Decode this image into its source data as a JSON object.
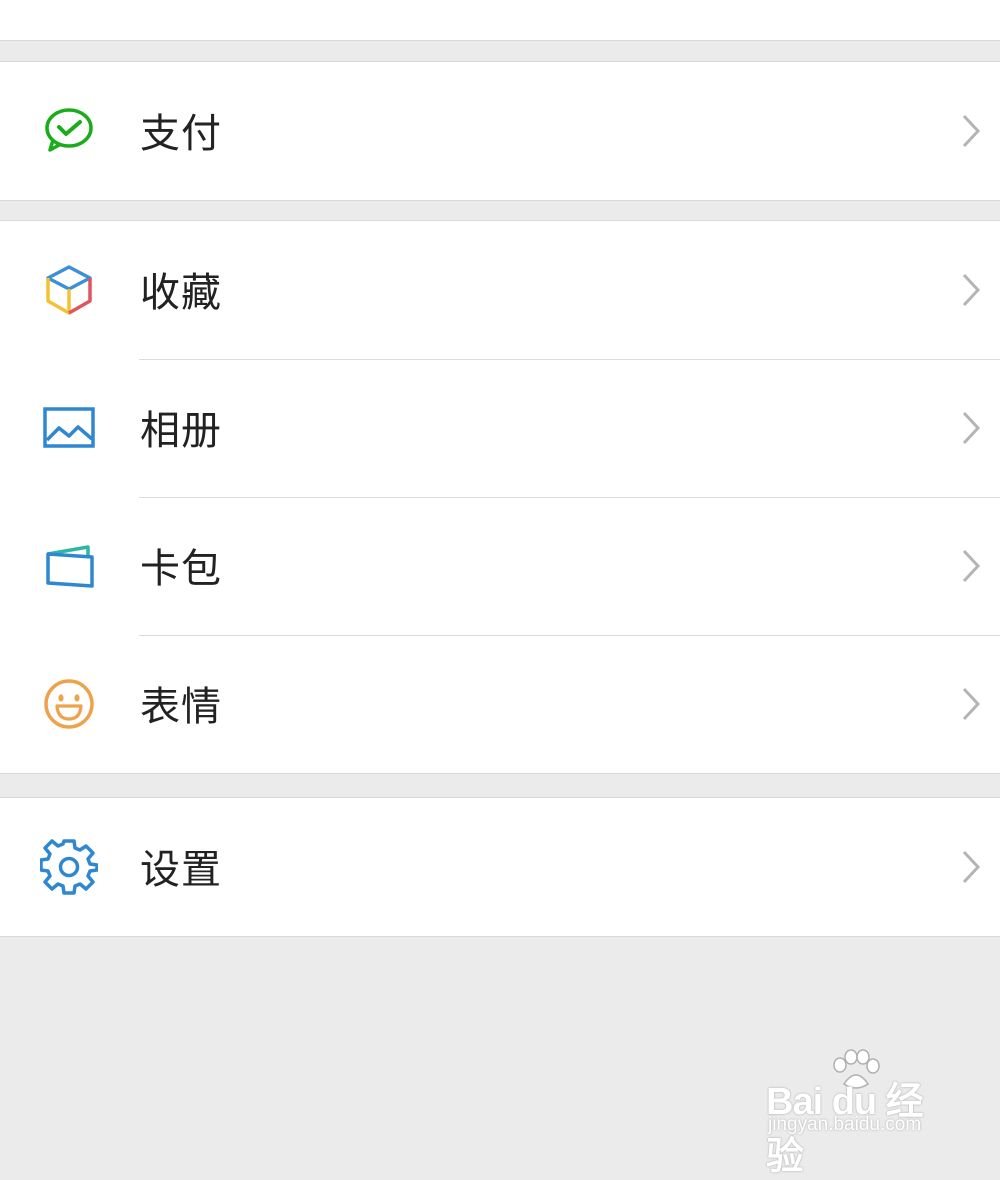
{
  "groups": [
    {
      "items": [
        {
          "label": "支付",
          "icon": "wechat-pay-icon"
        }
      ]
    },
    {
      "items": [
        {
          "label": "收藏",
          "icon": "favorites-cube-icon"
        },
        {
          "label": "相册",
          "icon": "album-picture-icon"
        },
        {
          "label": "卡包",
          "icon": "card-wallet-icon"
        },
        {
          "label": "表情",
          "icon": "smiley-face-icon"
        }
      ]
    },
    {
      "items": [
        {
          "label": "设置",
          "icon": "gear-icon"
        }
      ]
    }
  ],
  "watermark": {
    "logo": "Bai du 经验",
    "url": "jingyan.baidu.com"
  },
  "colors": {
    "pay_green": "#1aad19",
    "cube_blue": "#3d8fd6",
    "cube_yellow": "#f4c133",
    "cube_red": "#e0545f",
    "album_blue": "#2f86d1",
    "card_blue": "#2f86d1",
    "card_green": "#2fb6a0",
    "smiley_orange": "#eea24b",
    "settings_blue": "#2f86d1",
    "chevron_gray": "#b4b4b4",
    "separator": "#dcdcdc",
    "background": "#ebebeb"
  }
}
